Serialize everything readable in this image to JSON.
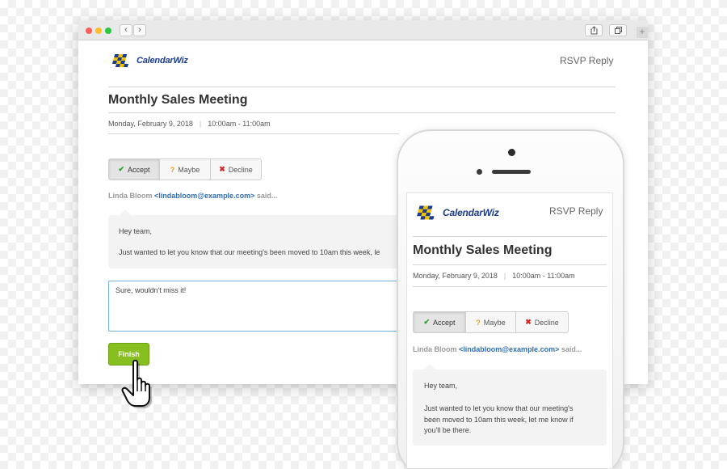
{
  "browser": {
    "back_label": "‹",
    "forward_label": "›",
    "new_tab_label": "+"
  },
  "app": {
    "logo_text": "CalendarWiz",
    "header_label": "RSVP Reply"
  },
  "event": {
    "title": "Monthly Sales Meeting",
    "date": "Monday, February 9, 2018",
    "time": "10:00am - 11:00am"
  },
  "rsvp_options": [
    {
      "label": "Accept",
      "icon": "check-icon",
      "selected": true
    },
    {
      "label": "Maybe",
      "icon": "question-icon",
      "selected": false
    },
    {
      "label": "Decline",
      "icon": "x-icon",
      "selected": false
    }
  ],
  "message": {
    "sender_name": "Linda Bloom",
    "sender_email": "<lindabloom@example.com>",
    "said_suffix": "said...",
    "greeting": "Hey team,",
    "body_desktop": "Just wanted to let you know that our meeting's been moved to 10am this week, le",
    "body_mobile_lines": [
      "Just wanted to let you know that our meeting's",
      "been moved to 10am this week, let me know if",
      "you'll be there."
    ]
  },
  "reply": {
    "text": "Sure, wouldn't miss it!"
  },
  "actions": {
    "finish_label": "Finish"
  },
  "colors": {
    "accent_green": "#86bf1f",
    "brand_blue": "#1b3c8c",
    "link_blue": "#2f6db5",
    "focus_border": "#6fb2dd"
  }
}
